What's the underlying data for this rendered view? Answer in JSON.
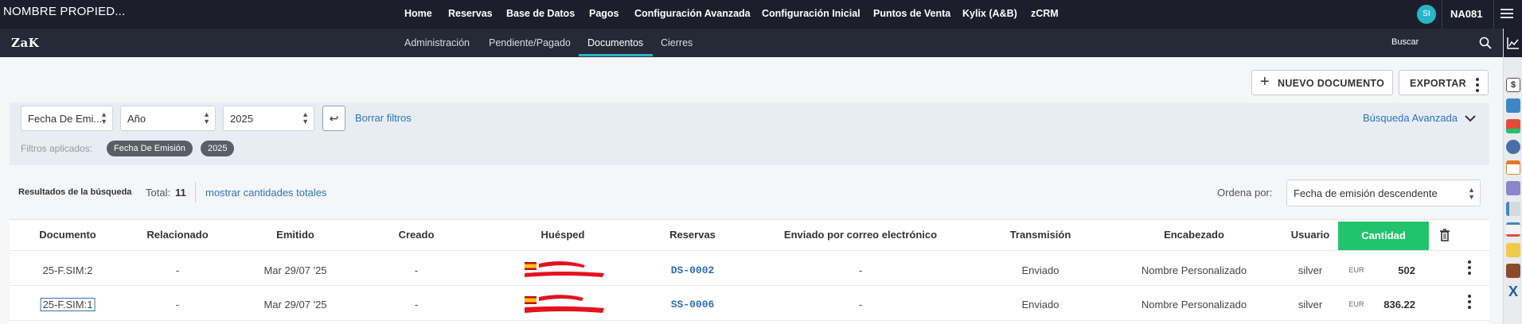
{
  "top_bar": {
    "property_name": "NOMBRE PROPIED...",
    "nav": [
      "Home",
      "Reservas",
      "Base de Datos",
      "Pagos",
      "Configuración Avanzada",
      "Configuración Inicial",
      "Puntos de Venta",
      "Kylix (A&B)",
      "zCRM"
    ],
    "avatar_initials": "SI",
    "user_code": "NA081"
  },
  "sub_bar": {
    "logo": "ZaK",
    "nav": [
      "Administración",
      "Pendiente/Pagado",
      "Documentos",
      "Cierres"
    ],
    "active": "Documentos",
    "search_label": "Buscar"
  },
  "actions": {
    "new_document": "NUEVO DOCUMENTO",
    "export": "EXPORTAR"
  },
  "filters": {
    "date_type": "Fecha De Emi...",
    "period": "Año",
    "year": "2025",
    "clear_label": "Borrar filtros",
    "advanced_search": "Búsqueda Avanzada",
    "applied_label": "Filtros aplicados:",
    "applied": [
      "Fecha De Emisión",
      "2025"
    ]
  },
  "results": {
    "title": "Resultados de la búsqueda",
    "total_label": "Total:",
    "total": "11",
    "show_totals": "mostrar cantidades totales",
    "order_label": "Ordena por:",
    "order_value": "Fecha de emisión descendente"
  },
  "table": {
    "headers": [
      "Documento",
      "Relacionado",
      "Emitido",
      "Creado",
      "Huésped",
      "Reservas",
      "Enviado por correo electrónico",
      "Transmisión",
      "Encabezado",
      "Usuario",
      "Cantidad"
    ],
    "rows": [
      {
        "documento": "25-F.SIM:2",
        "relacionado": "-",
        "emitido": "Mar 29/07 '25",
        "creado": "-",
        "reserva": "DS-0002",
        "enviado": "-",
        "transmision": "Enviado",
        "encabezado": "Nombre Personalizado",
        "usuario": "silver",
        "moneda": "EUR",
        "cantidad": "502"
      },
      {
        "documento": "25-F.SIM:1",
        "relacionado": "-",
        "emitido": "Mar 29/07 '25",
        "creado": "-",
        "reserva": "SS-0006",
        "enviado": "-",
        "transmision": "Enviado",
        "encabezado": "Nombre Personalizado",
        "usuario": "silver",
        "moneda": "EUR",
        "cantidad": "836.22"
      }
    ]
  },
  "colors": {
    "topbar": "#1c1f2b",
    "subbar": "#262a36",
    "accent": "#2bb4c8",
    "quantity_header": "#22c36d",
    "link": "#2d74b4",
    "redaction": "#e4121d"
  }
}
